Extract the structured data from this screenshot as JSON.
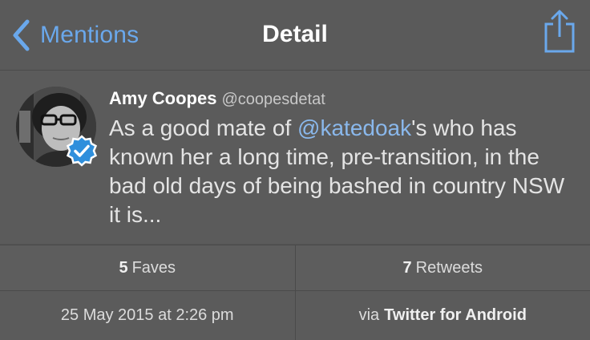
{
  "navbar": {
    "back_label": "Mentions",
    "title": "Detail",
    "back_icon": "chevron-left-icon",
    "share_icon": "share-icon",
    "accent_color": "#6aa8ec"
  },
  "tweet": {
    "author_name": "Amy Coopes",
    "author_handle": "@coopesdetat",
    "text_before": "As a good mate of ",
    "mention": "@katedoak",
    "text_after": "'s who has known her a long time, pre-transition, in the bad old days of being bashed in country NSW it is...",
    "verified_icon": "verified-badge-icon"
  },
  "stats": {
    "faves_count": "5",
    "faves_label": "Faves",
    "retweets_count": "7",
    "retweets_label": "Retweets"
  },
  "meta": {
    "timestamp": "25 May 2015 at 2:26 pm",
    "via_prefix": "via",
    "client": "Twitter for Android"
  }
}
